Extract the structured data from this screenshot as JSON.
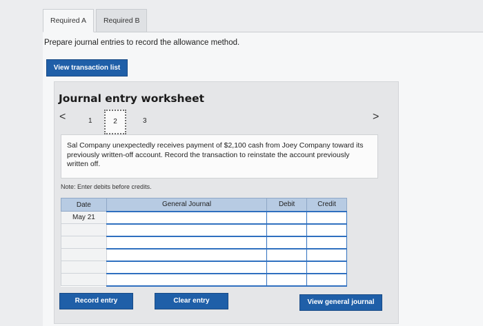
{
  "tabs": [
    {
      "label": "Required A",
      "active": true
    },
    {
      "label": "Required B",
      "active": false
    }
  ],
  "instruction": "Prepare journal entries to record the allowance method.",
  "buttons": {
    "view_transaction_list": "View transaction list",
    "record_entry": "Record entry",
    "clear_entry": "Clear entry",
    "view_general_journal": "View general journal"
  },
  "worksheet": {
    "title": "Journal entry worksheet",
    "pages": [
      "1",
      "2",
      "3"
    ],
    "current_page": "2",
    "prev_icon": "<",
    "next_icon": ">",
    "scenario": "Sal Company unexpectedly receives payment of $2,100 cash from Joey Company toward its previously written-off account. Record the transaction to reinstate the account previously written off.",
    "note": "Note: Enter debits before credits."
  },
  "journal": {
    "headers": {
      "date": "Date",
      "account": "General Journal",
      "debit": "Debit",
      "credit": "Credit"
    },
    "rows": [
      {
        "date": "May 21",
        "account": "",
        "debit": "",
        "credit": ""
      },
      {
        "date": "",
        "account": "",
        "debit": "",
        "credit": ""
      },
      {
        "date": "",
        "account": "",
        "debit": "",
        "credit": ""
      },
      {
        "date": "",
        "account": "",
        "debit": "",
        "credit": ""
      },
      {
        "date": "",
        "account": "",
        "debit": "",
        "credit": ""
      },
      {
        "date": "",
        "account": "",
        "debit": "",
        "credit": ""
      }
    ]
  },
  "colors": {
    "primary_button": "#1f5fa8",
    "table_header": "#b7cbe3",
    "input_border": "#2e6fbf"
  }
}
